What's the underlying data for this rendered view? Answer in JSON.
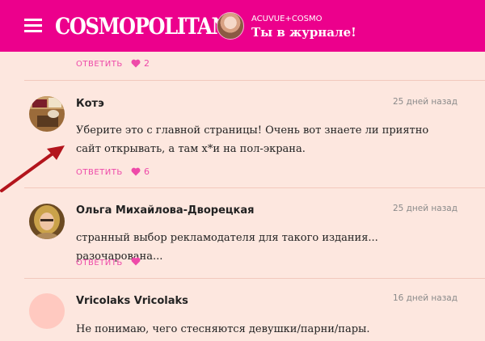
{
  "header": {
    "logo": "COSMOPOLITAN",
    "promo_brand": "ACUVUE+COSMO",
    "promo_title": "Ты в журнале!"
  },
  "top_actions": {
    "reply": "ОТВЕТИТЬ",
    "likes": "2"
  },
  "comments": [
    {
      "author": "Котэ",
      "date": "25 дней назад",
      "text": "Уберите это с главной страницы! Очень вот знаете ли приятно сайт открывать, а там х*и на пол-экрана.",
      "reply": "ОТВЕТИТЬ",
      "likes": "6"
    },
    {
      "author": "Ольга Михайлова-Дворецкая",
      "date": "25 дней назад",
      "text": "странный выбор рекламодателя для такого издания... разочарована...",
      "reply": "ОТВЕТИТЬ",
      "likes": ""
    },
    {
      "author": "Vricolaks Vricolaks",
      "date": "16 дней назад",
      "text": "Не понимаю, чего стесняются девушки/парни/пары."
    }
  ],
  "colors": {
    "brand": "#ec008c",
    "accent": "#ee4aa9",
    "background": "#fde7df"
  }
}
